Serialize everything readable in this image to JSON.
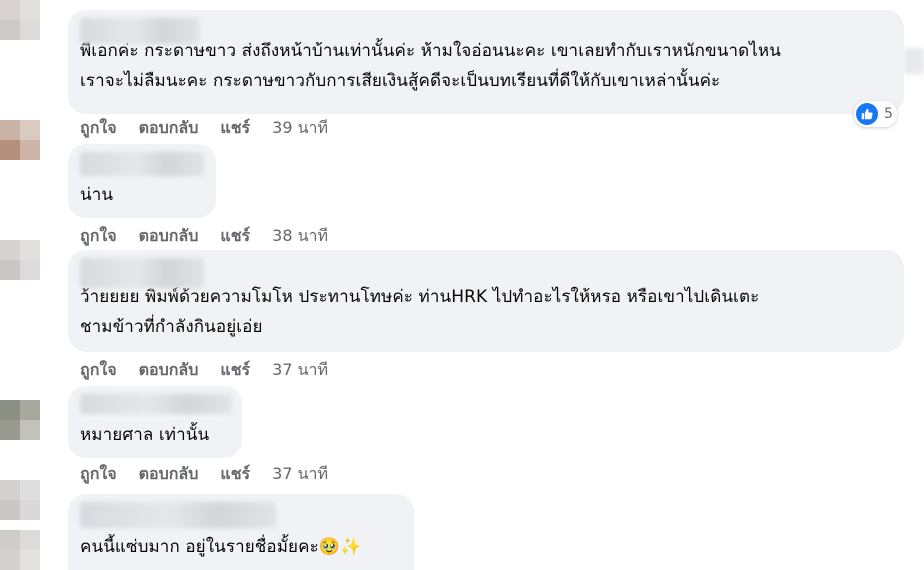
{
  "action_labels": {
    "like": "ถูกใจ",
    "reply": "ตอบกลับ",
    "share": "แชร์"
  },
  "comments": [
    {
      "lines": [
        "พี่เอกค่ะ กระดาษขาว ส่งถึงหน้าบ้านเท่านั้นค่ะ ห้ามใจอ่อนนะคะ เขาเลยทำกับเราหนักขนาดไหน",
        "เราจะไม่ลืมนะคะ กระดาษขาวกับการเสียเงินสู้คดีจะเป็นบทเรียนที่ดีให้กับเขาเหล่านั้นค่ะ"
      ],
      "time": "39 นาที",
      "reaction_count": "5"
    },
    {
      "lines": [
        "น่าน"
      ],
      "time": "38 นาที"
    },
    {
      "lines": [
        "ว้ายยยย พิมพ์ด้วยความโมโห ประทานโทษค่ะ ท่านHRK ไปทำอะไรให้หรอ หรือเขาไปเดินเตะ",
        "ชามข้าวที่กำลังกินอยู่เอ่ย"
      ],
      "time": "37 นาที"
    },
    {
      "lines": [
        "หมายศาล เท่านั้น"
      ],
      "time": "37 นาที"
    },
    {
      "lines": [
        "คนนี้แซ่บมาก อยู่ในรายชื่อมั้ยคะ🥹✨"
      ]
    }
  ],
  "icons": {
    "reaction": "like-icon"
  },
  "colors": {
    "bubble": "#f0f2f5",
    "action_text": "#65676b",
    "like_blue": "#1877f2"
  }
}
